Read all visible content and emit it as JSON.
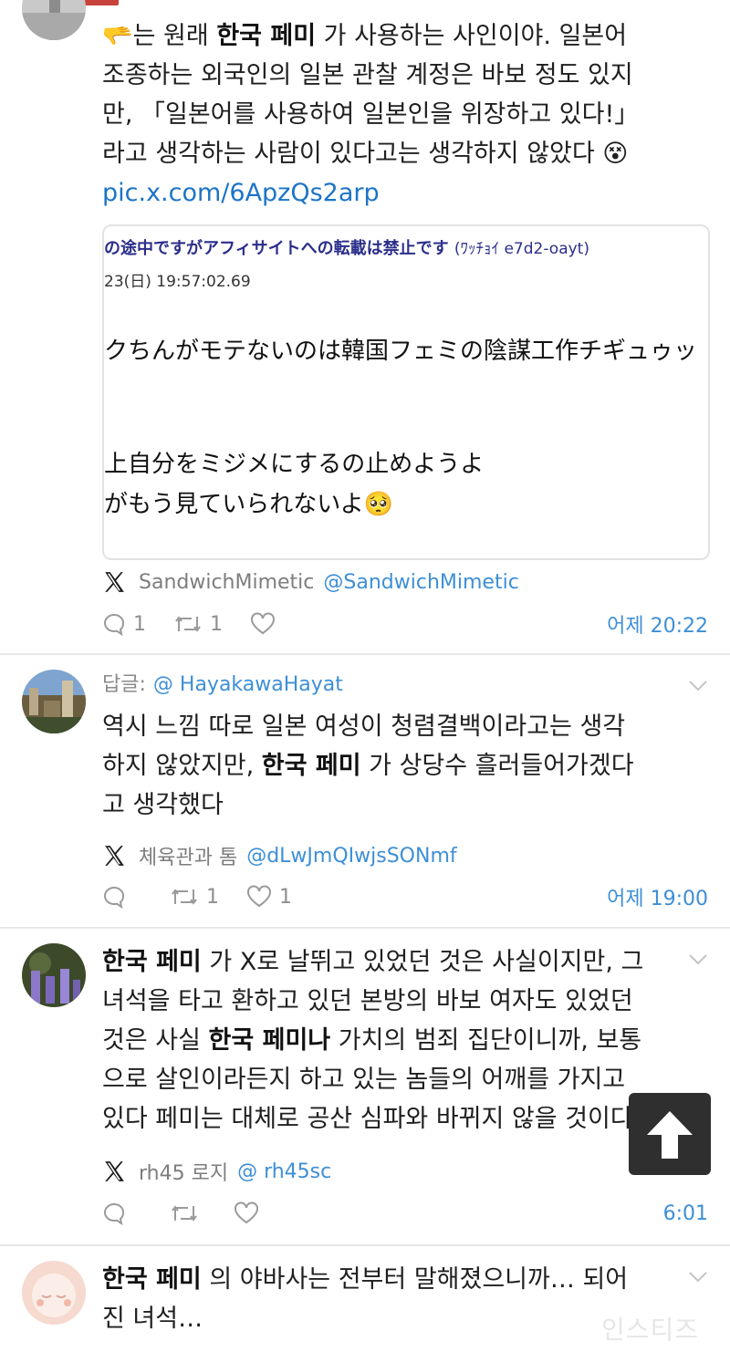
{
  "posts": [
    {
      "text_html": "<span data-name=\"pointing-hand-emoji\">🫳</span>는 원래 <b>한국 페미</b> 가 사용하는 사인이야. 일본어\n조종하는 외국인의 일본 관찰 계정은 바보 정도 있지\n만, 「일본어를 사용하여 일본인을 위장하고 있다!」\n라고 생각하는 사람이 있다고는 생각하지 않았다 <span data-name=\"dizzy-face-emoji\">😵</span>",
      "link": "pic.x.com/6ApzQs2arp",
      "quote": {
        "header": "の途中ですがアフィサイトへの転載は禁止です",
        "header_id": "(ﾜｯﾁｮｲ e7d2-oayt)",
        "date": "23(日) 19:57:02.69",
        "line1": "クちんがモテないのは韓国フェミの陰謀工作チギュゥッ",
        "line2": "上自分をミジメにするの止めようよ",
        "line3": "がもう見ていられないよ🥺"
      },
      "author_name": "SandwichMimetic",
      "author_handle": "@SandwichMimetic",
      "replies": "1",
      "reposts": "1",
      "likes": "",
      "time": "어제 20:22"
    },
    {
      "reply_label": "답글:",
      "reply_handle": "@ HayakawaHayat",
      "text_html": "역시 느낌 따로 일본 여성이 청렴결백이라고는 생각\n하지 않았지만, <b>한국 페미</b> 가 상당수 흘러들어가겠다\n고 생각했다",
      "author_name": "체육관과 톰",
      "author_handle": "@dLwJmQIwjsSONmf",
      "replies": "",
      "reposts": "1",
      "likes": "1",
      "time": "어제 19:00"
    },
    {
      "text_html": "<b>한국 페미</b> 가 X로 날뛰고 있었던 것은 사실이지만, 그\n녀석을 타고 환하고 있던 본방의 바보 여자도 있었던\n것은 사실 <b>한국 페미나</b> 가치의 범죄 집단이니까, 보통\n으로 살인이라든지 하고 있는 놈들의 어깨를 가지고\n있다 페미는 대체로 공산 심파와 바뀌지 않을 것이다",
      "author_name": "rh45 로지",
      "author_handle": "@ rh45sc",
      "replies": "",
      "reposts": "",
      "likes": "",
      "time": "6:01"
    },
    {
      "text_html": "<b>한국 페미</b> 의 야바사는 전부터 말해졌으니까… 되어\n진 녀석…"
    }
  ],
  "watermark": "인스티즈",
  "colors": {
    "link": "#1d74c7",
    "handle": "#3d8fd6",
    "accent_bar": "#c8423c"
  }
}
